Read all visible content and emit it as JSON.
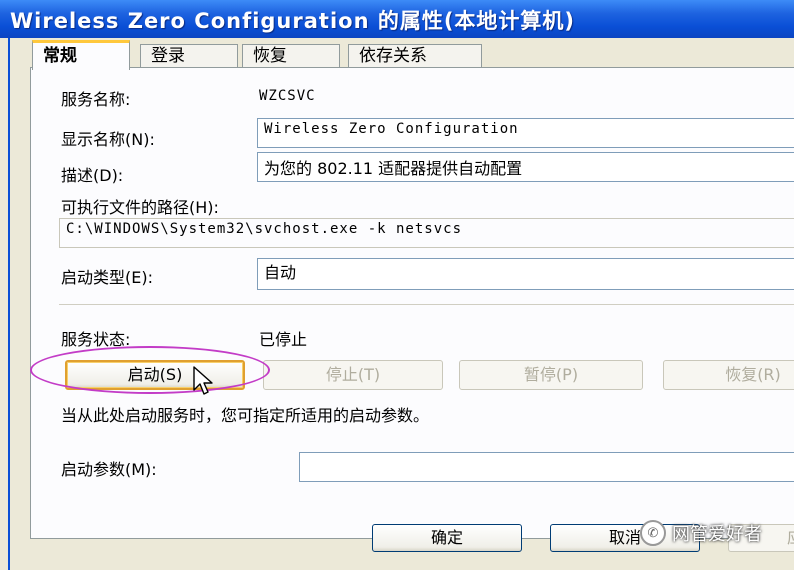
{
  "window": {
    "title": "Wireless Zero Configuration 的属性(本地计算机)"
  },
  "tabs": [
    {
      "label": "常规",
      "active": true
    },
    {
      "label": "登录",
      "active": false
    },
    {
      "label": "恢复",
      "active": false
    },
    {
      "label": "依存关系",
      "active": false
    }
  ],
  "general": {
    "service_name_label": "服务名称:",
    "service_name_value": "WZCSVC",
    "display_name_label": "显示名称(N):",
    "display_name_value": "Wireless Zero Configuration",
    "description_label": "描述(D):",
    "description_value": "为您的 802.11 适配器提供自动配置",
    "exe_path_label": "可执行文件的路径(H):",
    "exe_path_value": "C:\\WINDOWS\\System32\\svchost.exe -k netsvcs",
    "startup_type_label": "启动类型(E):",
    "startup_type_value": "自动",
    "service_status_label": "服务状态:",
    "service_status_value": "已停止",
    "start_button": "启动(S)",
    "stop_button": "停止(T)",
    "pause_button": "暂停(P)",
    "resume_button": "恢复(R)",
    "hint_text": "当从此处启动服务时，您可指定所适用的启动参数。",
    "start_params_label": "启动参数(M):",
    "start_params_value": ""
  },
  "footer": {
    "ok_button": "确定",
    "cancel_button": "取消",
    "apply_button": "应用"
  },
  "watermark": {
    "text": "网管爱好者"
  },
  "colors": {
    "titlebar": "#0a4fd6",
    "annotation_circle": "#c33cc7",
    "dialog_bg": "#ece9d8"
  },
  "icons": {
    "cursor": "arrow-cursor-icon",
    "watermark": "wechat-icon"
  }
}
